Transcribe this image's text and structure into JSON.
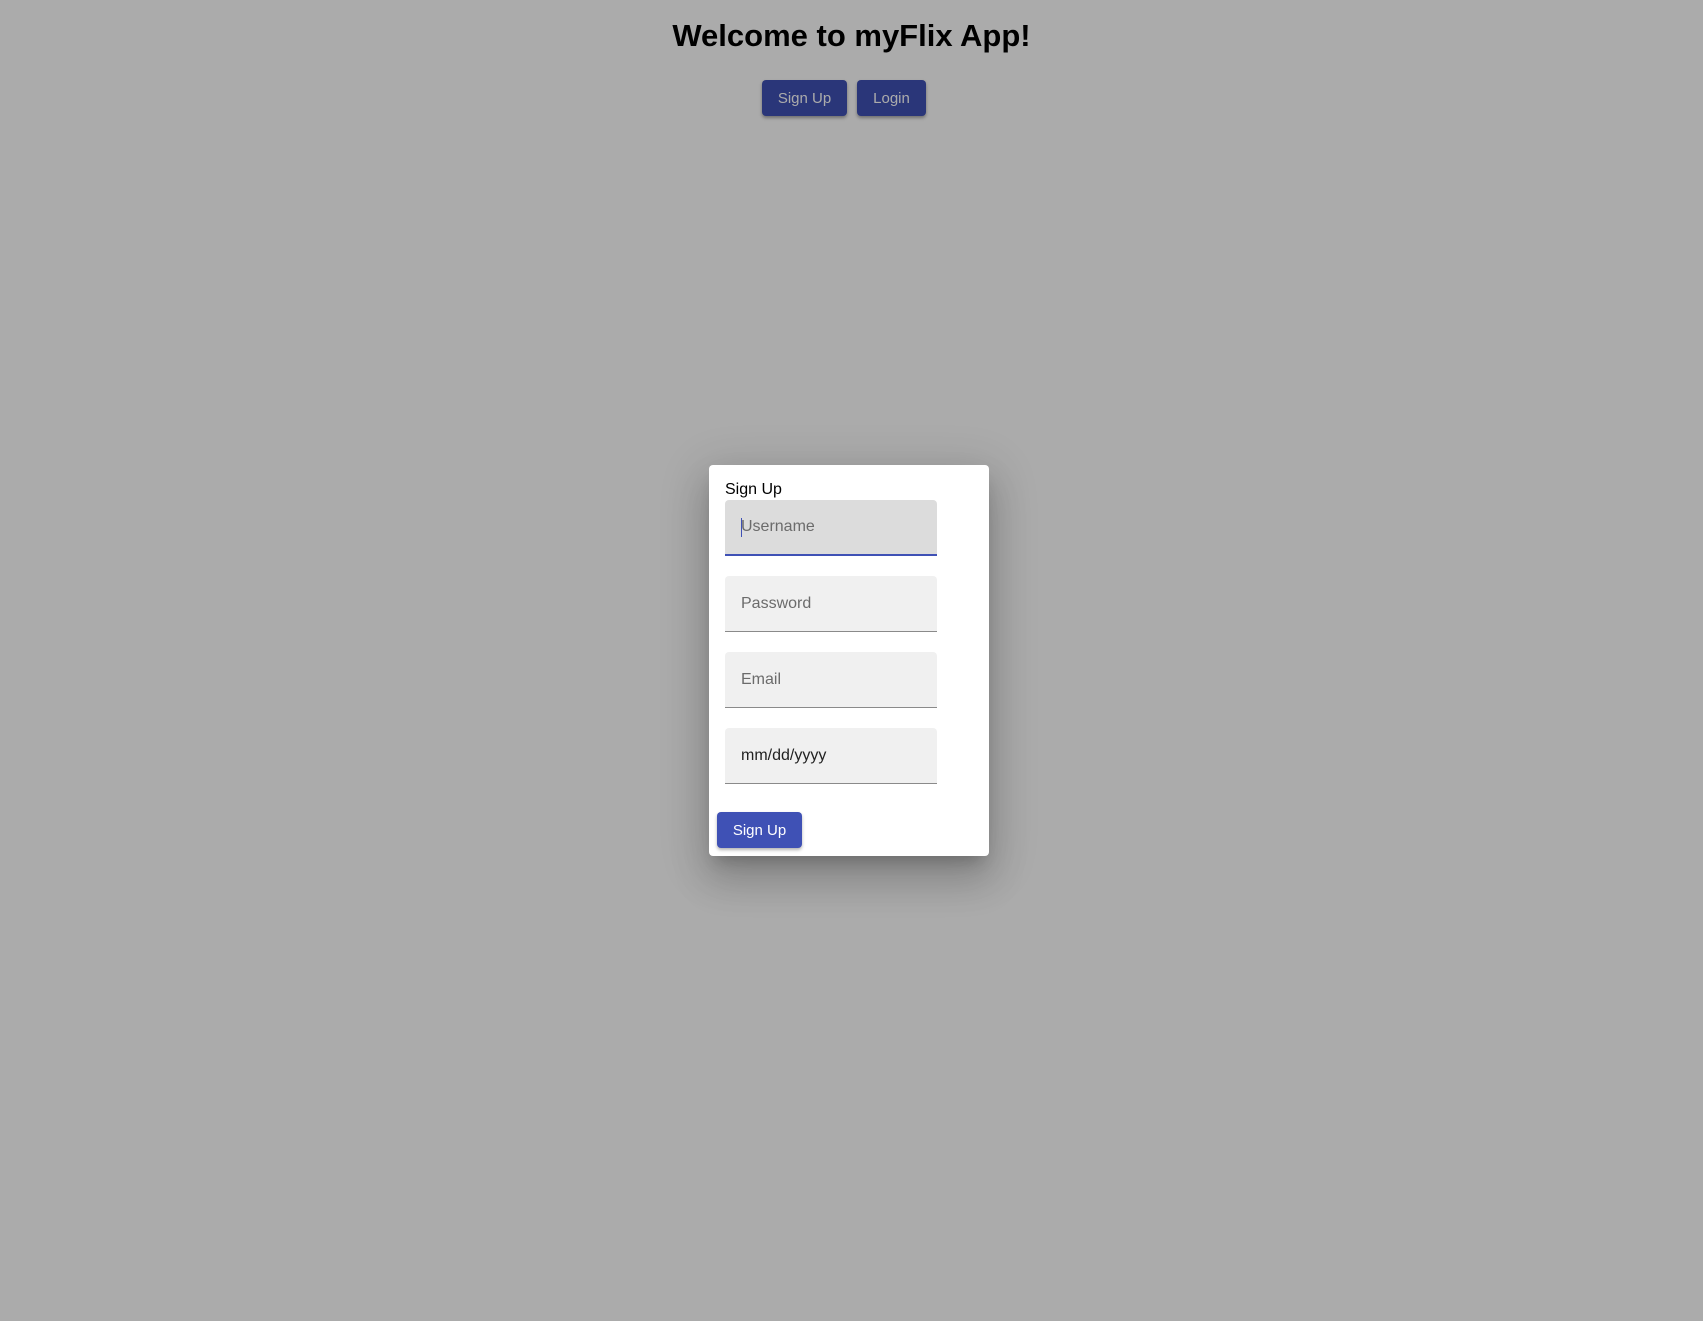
{
  "header": {
    "title": "Welcome to myFlix App!",
    "signup_label": "Sign Up",
    "login_label": "Login"
  },
  "dialog": {
    "title": "Sign Up",
    "fields": {
      "username": {
        "placeholder": "Username",
        "value": ""
      },
      "password": {
        "placeholder": "Password",
        "value": ""
      },
      "email": {
        "placeholder": "Email",
        "value": ""
      },
      "birthday": {
        "display": "mm/dd/yyyy"
      }
    },
    "submit_label": "Sign Up"
  },
  "colors": {
    "primary": "#3f51b5",
    "backdrop": "rgba(0,0,0,0.33)",
    "field_background": "#f0f0f0"
  }
}
